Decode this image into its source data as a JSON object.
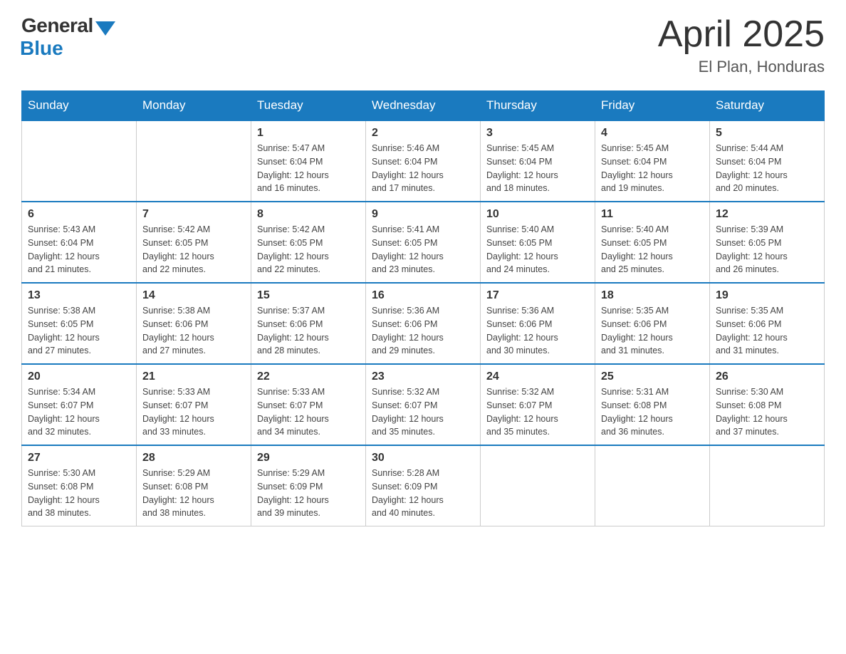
{
  "header": {
    "logo_general": "General",
    "logo_blue": "Blue",
    "month_year": "April 2025",
    "location": "El Plan, Honduras"
  },
  "days_of_week": [
    "Sunday",
    "Monday",
    "Tuesday",
    "Wednesday",
    "Thursday",
    "Friday",
    "Saturday"
  ],
  "weeks": [
    [
      {
        "day": "",
        "info": ""
      },
      {
        "day": "",
        "info": ""
      },
      {
        "day": "1",
        "info": "Sunrise: 5:47 AM\nSunset: 6:04 PM\nDaylight: 12 hours\nand 16 minutes."
      },
      {
        "day": "2",
        "info": "Sunrise: 5:46 AM\nSunset: 6:04 PM\nDaylight: 12 hours\nand 17 minutes."
      },
      {
        "day": "3",
        "info": "Sunrise: 5:45 AM\nSunset: 6:04 PM\nDaylight: 12 hours\nand 18 minutes."
      },
      {
        "day": "4",
        "info": "Sunrise: 5:45 AM\nSunset: 6:04 PM\nDaylight: 12 hours\nand 19 minutes."
      },
      {
        "day": "5",
        "info": "Sunrise: 5:44 AM\nSunset: 6:04 PM\nDaylight: 12 hours\nand 20 minutes."
      }
    ],
    [
      {
        "day": "6",
        "info": "Sunrise: 5:43 AM\nSunset: 6:04 PM\nDaylight: 12 hours\nand 21 minutes."
      },
      {
        "day": "7",
        "info": "Sunrise: 5:42 AM\nSunset: 6:05 PM\nDaylight: 12 hours\nand 22 minutes."
      },
      {
        "day": "8",
        "info": "Sunrise: 5:42 AM\nSunset: 6:05 PM\nDaylight: 12 hours\nand 22 minutes."
      },
      {
        "day": "9",
        "info": "Sunrise: 5:41 AM\nSunset: 6:05 PM\nDaylight: 12 hours\nand 23 minutes."
      },
      {
        "day": "10",
        "info": "Sunrise: 5:40 AM\nSunset: 6:05 PM\nDaylight: 12 hours\nand 24 minutes."
      },
      {
        "day": "11",
        "info": "Sunrise: 5:40 AM\nSunset: 6:05 PM\nDaylight: 12 hours\nand 25 minutes."
      },
      {
        "day": "12",
        "info": "Sunrise: 5:39 AM\nSunset: 6:05 PM\nDaylight: 12 hours\nand 26 minutes."
      }
    ],
    [
      {
        "day": "13",
        "info": "Sunrise: 5:38 AM\nSunset: 6:05 PM\nDaylight: 12 hours\nand 27 minutes."
      },
      {
        "day": "14",
        "info": "Sunrise: 5:38 AM\nSunset: 6:06 PM\nDaylight: 12 hours\nand 27 minutes."
      },
      {
        "day": "15",
        "info": "Sunrise: 5:37 AM\nSunset: 6:06 PM\nDaylight: 12 hours\nand 28 minutes."
      },
      {
        "day": "16",
        "info": "Sunrise: 5:36 AM\nSunset: 6:06 PM\nDaylight: 12 hours\nand 29 minutes."
      },
      {
        "day": "17",
        "info": "Sunrise: 5:36 AM\nSunset: 6:06 PM\nDaylight: 12 hours\nand 30 minutes."
      },
      {
        "day": "18",
        "info": "Sunrise: 5:35 AM\nSunset: 6:06 PM\nDaylight: 12 hours\nand 31 minutes."
      },
      {
        "day": "19",
        "info": "Sunrise: 5:35 AM\nSunset: 6:06 PM\nDaylight: 12 hours\nand 31 minutes."
      }
    ],
    [
      {
        "day": "20",
        "info": "Sunrise: 5:34 AM\nSunset: 6:07 PM\nDaylight: 12 hours\nand 32 minutes."
      },
      {
        "day": "21",
        "info": "Sunrise: 5:33 AM\nSunset: 6:07 PM\nDaylight: 12 hours\nand 33 minutes."
      },
      {
        "day": "22",
        "info": "Sunrise: 5:33 AM\nSunset: 6:07 PM\nDaylight: 12 hours\nand 34 minutes."
      },
      {
        "day": "23",
        "info": "Sunrise: 5:32 AM\nSunset: 6:07 PM\nDaylight: 12 hours\nand 35 minutes."
      },
      {
        "day": "24",
        "info": "Sunrise: 5:32 AM\nSunset: 6:07 PM\nDaylight: 12 hours\nand 35 minutes."
      },
      {
        "day": "25",
        "info": "Sunrise: 5:31 AM\nSunset: 6:08 PM\nDaylight: 12 hours\nand 36 minutes."
      },
      {
        "day": "26",
        "info": "Sunrise: 5:30 AM\nSunset: 6:08 PM\nDaylight: 12 hours\nand 37 minutes."
      }
    ],
    [
      {
        "day": "27",
        "info": "Sunrise: 5:30 AM\nSunset: 6:08 PM\nDaylight: 12 hours\nand 38 minutes."
      },
      {
        "day": "28",
        "info": "Sunrise: 5:29 AM\nSunset: 6:08 PM\nDaylight: 12 hours\nand 38 minutes."
      },
      {
        "day": "29",
        "info": "Sunrise: 5:29 AM\nSunset: 6:09 PM\nDaylight: 12 hours\nand 39 minutes."
      },
      {
        "day": "30",
        "info": "Sunrise: 5:28 AM\nSunset: 6:09 PM\nDaylight: 12 hours\nand 40 minutes."
      },
      {
        "day": "",
        "info": ""
      },
      {
        "day": "",
        "info": ""
      },
      {
        "day": "",
        "info": ""
      }
    ]
  ]
}
